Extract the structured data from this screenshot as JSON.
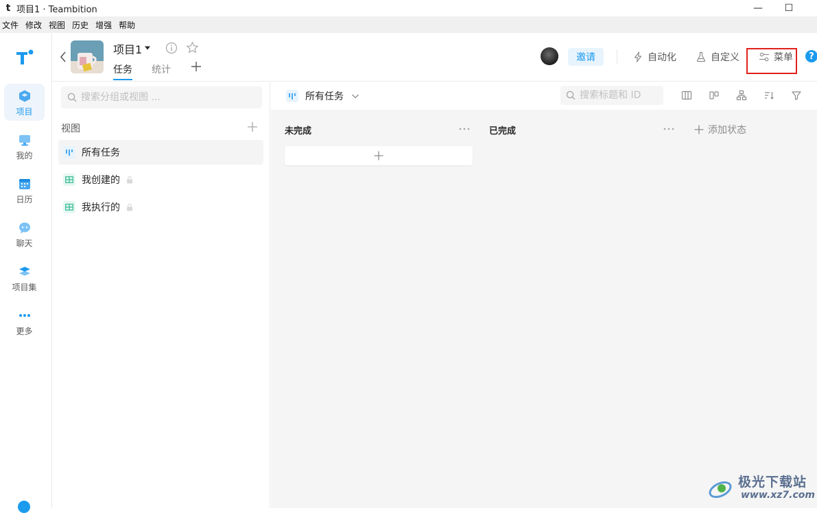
{
  "window": {
    "app_logo": "t",
    "title": "项目1 · Teambition",
    "minimize": "—",
    "maximize": "☐"
  },
  "menubar": [
    "文件",
    "修改",
    "视图",
    "历史",
    "增强",
    "帮助"
  ],
  "nav": {
    "items": [
      {
        "label": "项目",
        "icon": "cube-icon",
        "active": true
      },
      {
        "label": "我的",
        "icon": "monitor-icon"
      },
      {
        "label": "日历",
        "icon": "calendar-icon"
      },
      {
        "label": "聊天",
        "icon": "chat-icon"
      },
      {
        "label": "项目集",
        "icon": "layers-icon"
      },
      {
        "label": "更多",
        "icon": "more-dots-icon"
      }
    ]
  },
  "header": {
    "project_name": "项目1",
    "tabs": [
      {
        "label": "任务",
        "active": true
      },
      {
        "label": "统计",
        "active": false
      }
    ],
    "invite_label": "邀请",
    "automation_label": "自动化",
    "custom_label": "自定义",
    "menu_label": "菜单",
    "help_label": "?"
  },
  "views_panel": {
    "search_placeholder": "搜索分组或视图 ...",
    "section_title": "视图",
    "items": [
      {
        "label": "所有任务",
        "icon": "board-view-icon",
        "active": true
      },
      {
        "label": "我创建的",
        "icon": "table-view-icon",
        "locked": true
      },
      {
        "label": "我执行的",
        "icon": "table-view-icon",
        "locked": true
      }
    ]
  },
  "board": {
    "current_view": "所有任务",
    "search_placeholder": "搜索标题和 ID",
    "columns": [
      {
        "title": "未完成"
      },
      {
        "title": "已完成"
      }
    ],
    "add_status_label": "添加状态"
  },
  "watermark": {
    "line1": "极光下载站",
    "line2": "www.xz7.com"
  },
  "colors": {
    "accent": "#1b9aee",
    "highlight_box": "#e0201b"
  }
}
